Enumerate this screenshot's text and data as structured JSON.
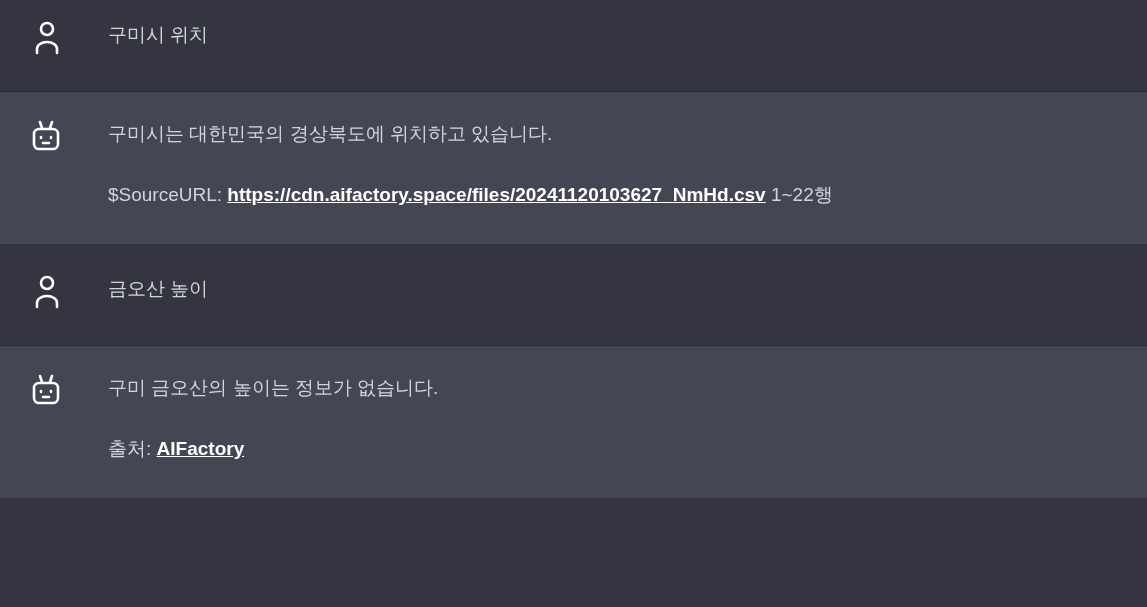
{
  "messages": [
    {
      "kind": "user",
      "paragraphs": [
        {
          "text": "구미시 위치"
        }
      ]
    },
    {
      "kind": "assistant",
      "paragraphs": [
        {
          "text": "구미시는 대한민국의 경상북도에 위치하고 있습니다."
        },
        {
          "text": "$SourceURL: ",
          "link": "https://cdn.aifactory.space/files/20241120103627_NmHd.csv",
          "suffix": " 1~22행"
        }
      ]
    },
    {
      "kind": "user",
      "paragraphs": [
        {
          "text": "금오산 높이"
        }
      ]
    },
    {
      "kind": "assistant",
      "paragraphs": [
        {
          "text": "구미 금오산의 높이는 정보가 없습니다."
        },
        {
          "text": "출처: ",
          "link": "AIFactory"
        }
      ]
    }
  ]
}
